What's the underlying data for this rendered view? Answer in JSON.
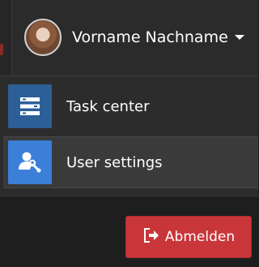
{
  "user_menu": {
    "name": "Vorname Nachname",
    "avatar_icon": "user-avatar",
    "caret_icon": "caret-down-icon"
  },
  "menu": {
    "items": [
      {
        "label": "Task center",
        "icon": "task-center-icon",
        "icon_color": "#2c5f97"
      },
      {
        "label": "User settings",
        "icon": "user-settings-icon",
        "icon_color": "#3b7fd8"
      }
    ]
  },
  "logout": {
    "label": "Abmelden",
    "icon": "sign-out-icon",
    "color": "#c9363a"
  }
}
